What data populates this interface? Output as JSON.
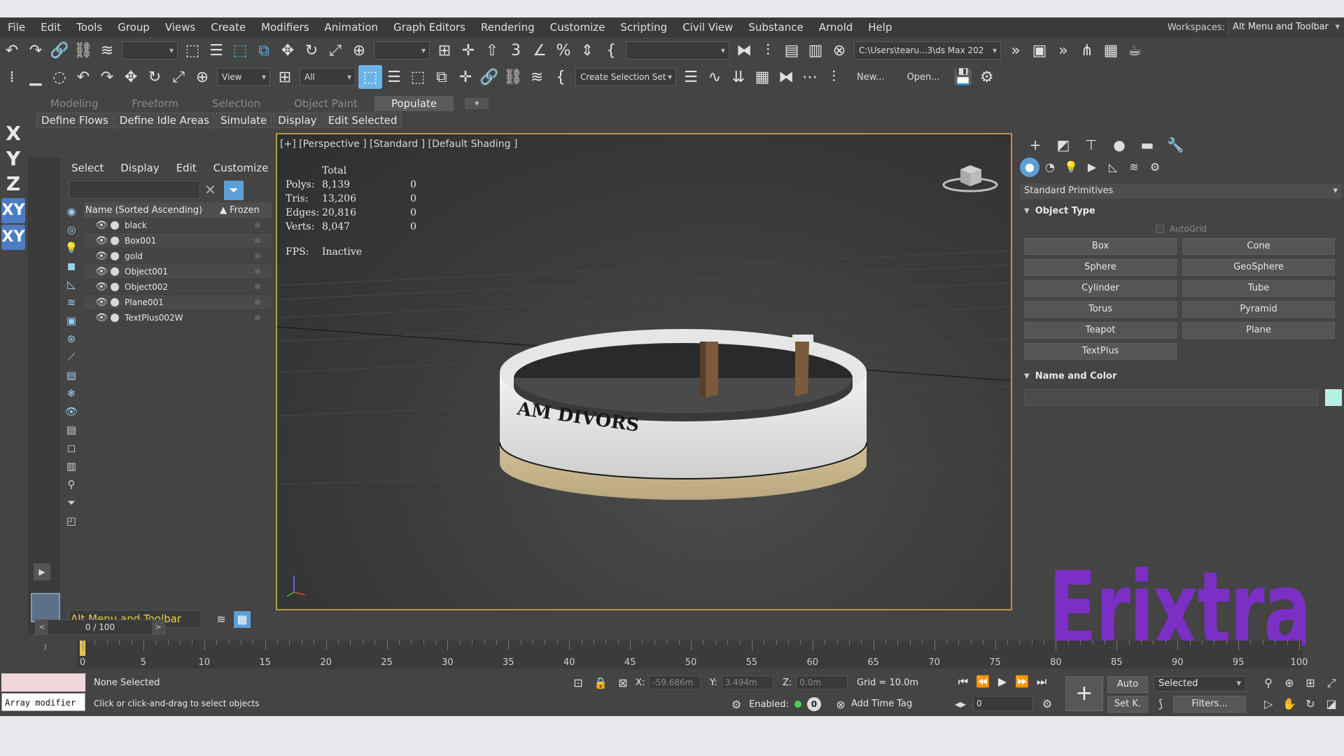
{
  "menu": [
    "File",
    "Edit",
    "Tools",
    "Group",
    "Views",
    "Create",
    "Modifiers",
    "Animation",
    "Graph Editors",
    "Rendering",
    "Customize",
    "Scripting",
    "Civil View",
    "Substance",
    "Arnold",
    "Help"
  ],
  "workspaces": {
    "label": "Workspaces:",
    "value": "Alt Menu and Toolbar"
  },
  "toolbar1": {
    "project_path": "C:\\Users\\tearu...3\\ds Max 202"
  },
  "toolbar2": {
    "view_dd": "View",
    "all_dd": "All",
    "selection_set": "Create Selection Set",
    "new_label": "New...",
    "open_label": "Open..."
  },
  "ribbon": {
    "tabs": [
      "Modeling",
      "Freeform",
      "Selection",
      "Object Paint",
      "Populate"
    ],
    "active_tab": "Populate",
    "populate_buttons": [
      "Define Flows",
      "Define Idle Areas",
      "Simulate",
      "Display",
      "Edit Selected"
    ]
  },
  "axis_constraints": [
    "X",
    "Y",
    "Z",
    "XY",
    "XY"
  ],
  "explorer": {
    "menu": [
      "Select",
      "Display",
      "Edit",
      "Customize"
    ],
    "col_name": "Name (Sorted Ascending)",
    "col_frozen": "▲ Frozen",
    "objects": [
      "black",
      "Box001",
      "gold",
      "Object001",
      "Object002",
      "Plane001",
      "TextPlus002W"
    ],
    "layer_dd": "Alt Menu and Toolbar"
  },
  "viewport": {
    "label": "[+] [Perspective ] [Standard ] [Default Shading ]",
    "stats": {
      "total_label": "Total",
      "rows": [
        {
          "k": "Polys:",
          "v": "8,139",
          "z": "0"
        },
        {
          "k": "Tris:",
          "v": "13,206",
          "z": "0"
        },
        {
          "k": "Edges:",
          "v": "20,816",
          "z": "0"
        },
        {
          "k": "Verts:",
          "v": "8,047",
          "z": "0"
        }
      ],
      "fps_label": "FPS:",
      "fps_value": "Inactive"
    },
    "ring_text": "AM DIVORS"
  },
  "command_panel": {
    "category": "Standard Primitives",
    "object_type_title": "Object Type",
    "autogrid": "AutoGrid",
    "primitives": [
      "Box",
      "Cone",
      "Sphere",
      "GeoSphere",
      "Cylinder",
      "Tube",
      "Torus",
      "Pyramid",
      "Teapot",
      "Plane",
      "TextPlus"
    ],
    "name_color_title": "Name and Color",
    "color": "#b5f0e4"
  },
  "timeline": {
    "slider": "0 / 100",
    "ticks": [
      "0",
      "5",
      "10",
      "15",
      "20",
      "25",
      "30",
      "35",
      "40",
      "45",
      "50",
      "55",
      "60",
      "65",
      "70",
      "75",
      "80",
      "85",
      "90",
      "95",
      "100"
    ]
  },
  "status": {
    "script_line": "Array modifier",
    "selection": "None Selected",
    "hint": "Click or click-and-drag to select objects",
    "x_label": "X:",
    "x_value": "-59.686m",
    "y_label": "Y:",
    "y_value": "3.494m",
    "z_label": "Z:",
    "z_value": "0.0m",
    "grid": "Grid = 10.0m",
    "enabled_label": "Enabled:",
    "add_time_tag": "Add Time Tag",
    "frame": "0",
    "auto": "Auto",
    "set_key": "Set K.",
    "selected_dd": "Selected",
    "filters": "Filters..."
  },
  "watermark": "Erixtra"
}
